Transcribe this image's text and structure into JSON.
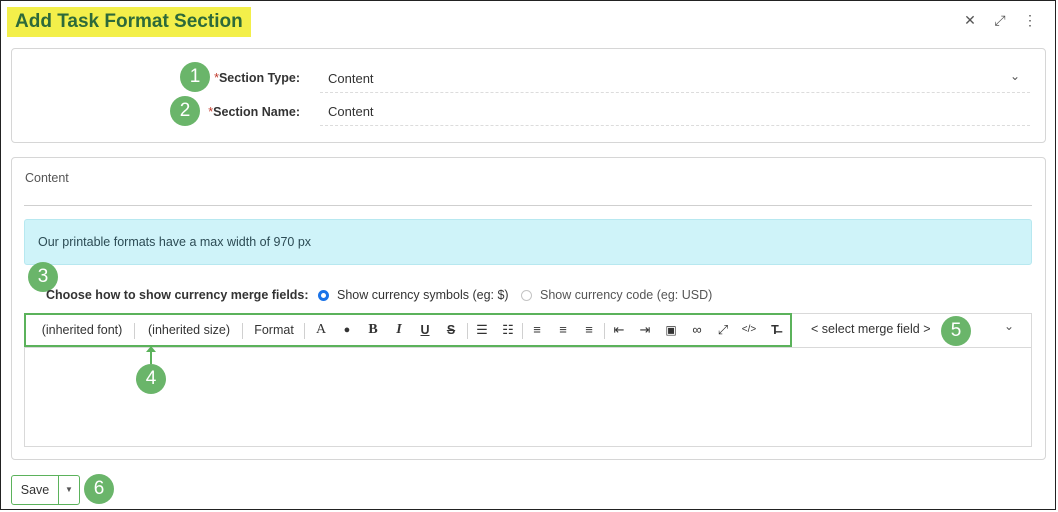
{
  "window": {
    "title": "Add Task Format Section"
  },
  "form": {
    "section_type": {
      "required_mark": "*",
      "label": "Section Type:",
      "value": "Content"
    },
    "section_name": {
      "required_mark": "*",
      "label": "Section Name:",
      "value": "Content"
    }
  },
  "content_panel": {
    "heading": "Content",
    "info_text": "Our printable formats have a max width of 970 px",
    "currency": {
      "label": "Choose how to show currency merge fields:",
      "options": [
        {
          "label": "Show currency symbols (eg: $)",
          "selected": true
        },
        {
          "label": "Show currency code (eg: USD)",
          "selected": false
        }
      ]
    },
    "toolbar": {
      "font": "(inherited font)",
      "size": "(inherited size)",
      "format": "Format",
      "icons": [
        "font-color-icon",
        "background-color-icon",
        "bold-icon",
        "italic-icon",
        "underline-icon",
        "strikethrough-icon",
        "ordered-list-icon",
        "unordered-list-icon",
        "align-left-icon",
        "align-center-icon",
        "align-right-icon",
        "outdent-icon",
        "indent-icon",
        "image-icon",
        "link-icon",
        "fullscreen-icon",
        "source-code-icon",
        "clear-format-icon"
      ],
      "merge_field": "< select merge field >"
    }
  },
  "footer": {
    "save_label": "Save"
  },
  "callouts": [
    "1",
    "2",
    "3",
    "4",
    "5",
    "6"
  ],
  "colors": {
    "title_highlight": "#f3ef4a",
    "title_text": "#2d6a3a",
    "callout": "#6ab56a",
    "info_bg": "#cff3f9",
    "radio_on": "#1a73e8"
  }
}
